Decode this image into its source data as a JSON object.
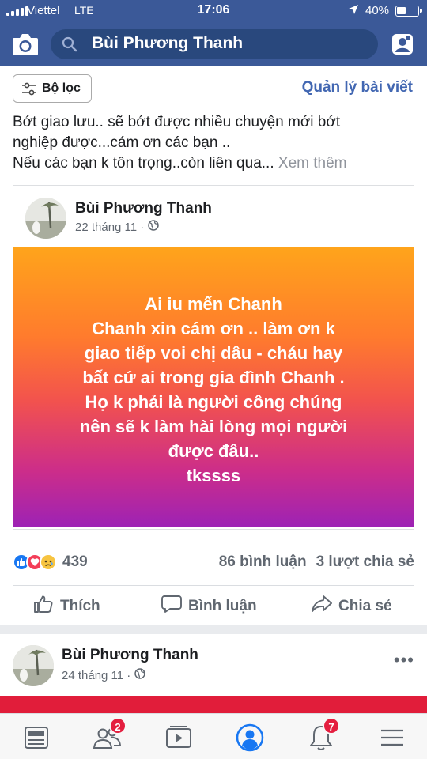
{
  "status_bar": {
    "carrier": "Viettel",
    "network": "LTE",
    "time": "17:06",
    "battery": "40%"
  },
  "header": {
    "search_text": "Bùi Phương Thanh",
    "icons": [
      "camera-icon",
      "search-icon",
      "profile-icon"
    ]
  },
  "toolbar": {
    "filter_label": "Bộ lọc",
    "manage_label": "Quản lý bài viết"
  },
  "post": {
    "text_line1": "Bớt giao lưu.. sẽ bớt được nhiều chuyện mới bớt",
    "text_line2": "nghiệp được...cám ơn các bạn ..",
    "text_line3": "Nếu các bạn k tôn trọng..còn liên qua...",
    "see_more": "Xem thêm",
    "shared": {
      "author": "Bùi Phương Thanh",
      "date": "22 tháng 11 ·",
      "lines": [
        "Ai iu mến Chanh",
        "Chanh xin cám ơn .. làm ơn k",
        "giao tiếp voi chị dâu - cháu hay",
        "bất cứ ai trong gia đình Chanh .",
        "Họ k phải là người công chúng",
        "nên sẽ k làm hài lòng mọi người",
        "được đâu..",
        "tkssss"
      ]
    },
    "reaction_count": "439",
    "comments": "86 bình luận",
    "shares": "3 lượt chia sẻ",
    "actions": {
      "like": "Thích",
      "comment": "Bình luận",
      "share": "Chia sẻ"
    }
  },
  "post2": {
    "author": "Bùi Phương Thanh",
    "date": "24 tháng 11 ·",
    "more": "•••"
  },
  "bottom_nav": {
    "friends_badge": "2",
    "notifications_badge": "7"
  },
  "colors": {
    "brand": "#3b5998",
    "link": "#4267b2",
    "badge": "#e41e3f"
  }
}
